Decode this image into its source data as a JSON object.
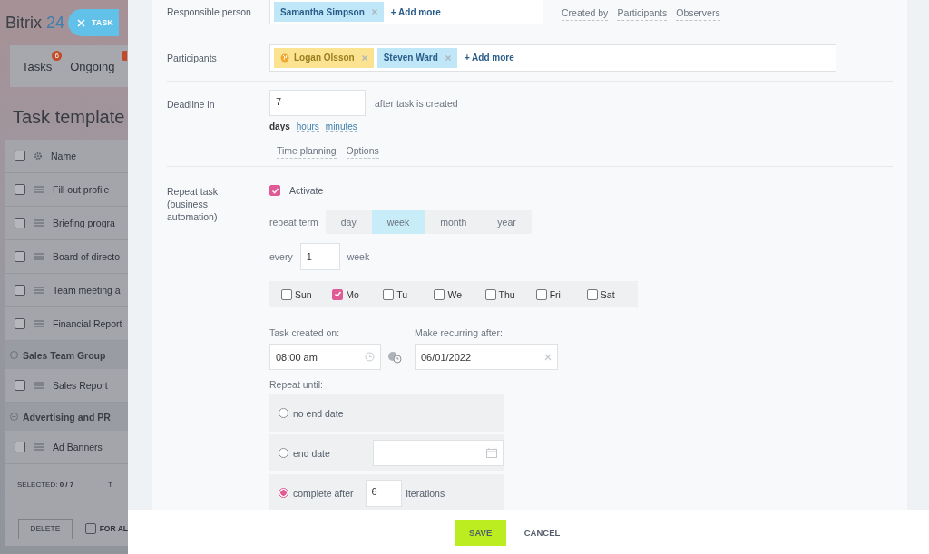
{
  "background_page": {
    "logo": {
      "text": "Bitrix",
      "accent": "24"
    },
    "task_tab": {
      "label": "TASK"
    },
    "tabs": [
      {
        "label": "Tasks",
        "counter": "6"
      },
      {
        "label": "Ongoing",
        "counter_dot": true
      }
    ],
    "page_title": "Task template",
    "table": {
      "header": {
        "label": "Name",
        "checked": false
      },
      "rows": [
        {
          "kind": "item",
          "label": "Fill out profile",
          "checked": false
        },
        {
          "kind": "item",
          "label": "Briefing progra",
          "checked": false
        },
        {
          "kind": "item",
          "label": "Board of directo",
          "checked": false
        },
        {
          "kind": "item",
          "label": "Team meeting a",
          "checked": false
        },
        {
          "kind": "item",
          "label": "Financial Report",
          "checked": false
        },
        {
          "kind": "group",
          "label": "Sales Team Group"
        },
        {
          "kind": "item",
          "label": "Sales Report",
          "checked": false
        },
        {
          "kind": "group",
          "label": "Advertising and PR"
        },
        {
          "kind": "item",
          "label": "Ad Banners",
          "checked": false
        }
      ],
      "selected_label": "SELECTED:",
      "selected_value": "0 / 7",
      "total_label": "T"
    },
    "delete_button": "DELETE",
    "for_all": {
      "label": "FOR AL",
      "checked": false
    }
  },
  "form": {
    "responsible": {
      "label": "Responsible person",
      "people": [
        {
          "name": "Samantha Simpson",
          "kind": "user"
        }
      ],
      "add_more": "+ Add more",
      "links": [
        "Created by",
        "Participants",
        "Observers"
      ]
    },
    "participants": {
      "label": "Participants",
      "people": [
        {
          "name": "Logan Olsson",
          "kind": "external"
        },
        {
          "name": "Steven Ward",
          "kind": "user"
        }
      ],
      "add_more": "+ Add more"
    },
    "deadline": {
      "label": "Deadline in",
      "value": "7",
      "suffix": "after task is created",
      "units": [
        {
          "label": "days",
          "selected": true
        },
        {
          "label": "hours",
          "selected": false
        },
        {
          "label": "minutes",
          "selected": false
        }
      ],
      "links": [
        "Time planning",
        "Options"
      ]
    },
    "repeat": {
      "label": "Repeat task (business automation)",
      "activate": {
        "label": "Activate",
        "checked": true
      },
      "term_label": "repeat term",
      "terms": [
        {
          "label": "day",
          "selected": false
        },
        {
          "label": "week",
          "selected": true
        },
        {
          "label": "month",
          "selected": false
        },
        {
          "label": "year",
          "selected": false
        }
      ],
      "every_label": "every",
      "every_value": "1",
      "every_unit": "week",
      "days": [
        {
          "label": "Sun",
          "checked": false
        },
        {
          "label": "Mo",
          "checked": true
        },
        {
          "label": "Tu",
          "checked": false
        },
        {
          "label": "We",
          "checked": false
        },
        {
          "label": "Thu",
          "checked": false
        },
        {
          "label": "Fri",
          "checked": false
        },
        {
          "label": "Sat",
          "checked": false
        }
      ],
      "created_label": "Task created on:",
      "created_value": "08:00 am",
      "recurring_label": "Make recurring after:",
      "recurring_value": "06/01/2022",
      "until_label": "Repeat until:",
      "until_options": [
        {
          "kind": "none",
          "label": "no end date",
          "selected": false
        },
        {
          "kind": "date",
          "label": "end date",
          "selected": false
        },
        {
          "kind": "count",
          "label": "complete after",
          "value": "6",
          "suffix": "iterations",
          "selected": true
        }
      ]
    }
  },
  "footer": {
    "save": "SAVE",
    "cancel": "CANCEL"
  }
}
